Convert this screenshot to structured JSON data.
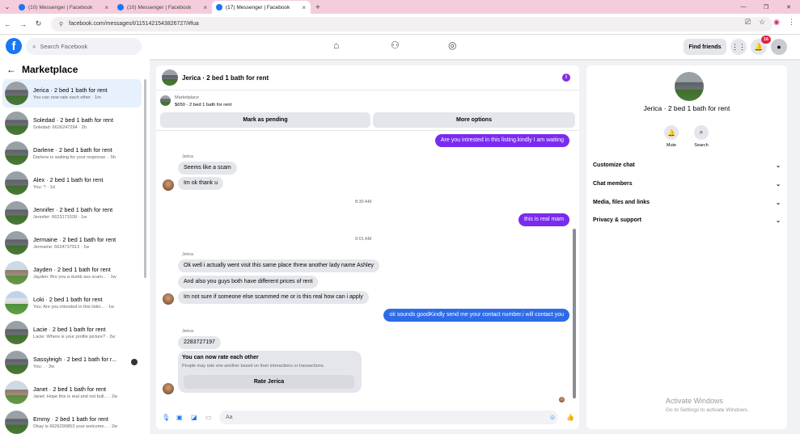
{
  "browser": {
    "tabs": [
      {
        "label": "(10) Messenger | Facebook"
      },
      {
        "label": "(10) Messenger | Facebook"
      },
      {
        "label": "(17) Messenger | Facebook"
      }
    ],
    "url": "facebook.com/messages/t/1151421543826727/#fua"
  },
  "header": {
    "search_placeholder": "Search Facebook",
    "find_friends": "Find friends",
    "notification_count": "16"
  },
  "sidebar": {
    "title": "Marketplace",
    "conversations": [
      {
        "name": "Jerica · 2 bed 1 bath for rent",
        "preview": "You can now rate each other · 1m"
      },
      {
        "name": "Soledad · 2 bed 1 bath for rent",
        "preview": "Soledad: 6626247294 · 2h"
      },
      {
        "name": "Darlene · 2 bed 1 bath for rent",
        "preview": "Darlene is waiting for your response. · 5h"
      },
      {
        "name": "Alex · 2 bed 1 bath for rent",
        "preview": "You: ? · 1d"
      },
      {
        "name": "Jennifer · 2 bed 1 bath for rent",
        "preview": "Jennifer: 6623171539 · 1w"
      },
      {
        "name": "Jermaine · 2 bed 1 bath for rent",
        "preview": "Jermaine: 6624737913 · 1w"
      },
      {
        "name": "Jayden · 2 bed 1 bath for rent",
        "preview": "Jayden: Bro you a dumb ass scam... · 1w"
      },
      {
        "name": "Loki · 2 bed 1 bath for rent",
        "preview": "You: Are you intrested in this listin... · 1w"
      },
      {
        "name": "Lacie · 2 bed 1 bath for rent",
        "preview": "Lacie: Where is your profile picture? · 2w"
      },
      {
        "name": "Sassyleigh · 2 bed 1 bath for r...",
        "preview": "You: . · 2w"
      },
      {
        "name": "Janet · 2 bed 1 bath for rent",
        "preview": "Janet: Hope this is real and not bull... · 2w"
      },
      {
        "name": "Emmy · 2 bed 1 bath for rent",
        "preview": "Okay is 6626290853 your welcome... · 2w"
      }
    ]
  },
  "chat": {
    "title": "Jerica · 2 bed 1 bath for rent",
    "marketplace_label": "Marketplace",
    "listing": "$650 - 2 bed 1 bath for rent",
    "mark_pending": "Mark as pending",
    "more_options": "More options",
    "messages": {
      "m1": "Are you intrested in this listing.kindly I am waiting",
      "sender1": "Jerica",
      "m2": "Seems like a scam",
      "m3": "Im ok thank u",
      "ts1": "8:30 AM",
      "m4": "this is real mam",
      "ts2": "9:01 AM",
      "sender2": "Jerica",
      "m5": "Ok well i actually went visit this same place threw another lady name Ashley",
      "m6": "And also you guys both have different prices of rent",
      "m7": "Im not sure if someone else scammed me or is this real how can i apply",
      "m8": "ok sounds goodKindly send me your contact number.i will contact you",
      "sender3": "Jerica",
      "m9": "2283727197"
    },
    "rate_card": {
      "title": "You can now rate each other",
      "subtitle": "People may rate one another based on their interactions or transactions.",
      "button": "Rate Jerica"
    },
    "input_placeholder": "Aa"
  },
  "info": {
    "title": "Jerica · 2 bed 1 bath for rent",
    "mute": "Mute",
    "search": "Search",
    "rows": [
      "Customize chat",
      "Chat members",
      "Media, files and links",
      "Privacy & support"
    ]
  },
  "watermark": {
    "line1": "Activate Windows",
    "line2": "Go to Settings to activate Windows."
  },
  "colors": {
    "outgoing_purple": "#7a2bf0",
    "outgoing_blue": "#2e6be6",
    "facebook_blue": "#1877f2"
  }
}
